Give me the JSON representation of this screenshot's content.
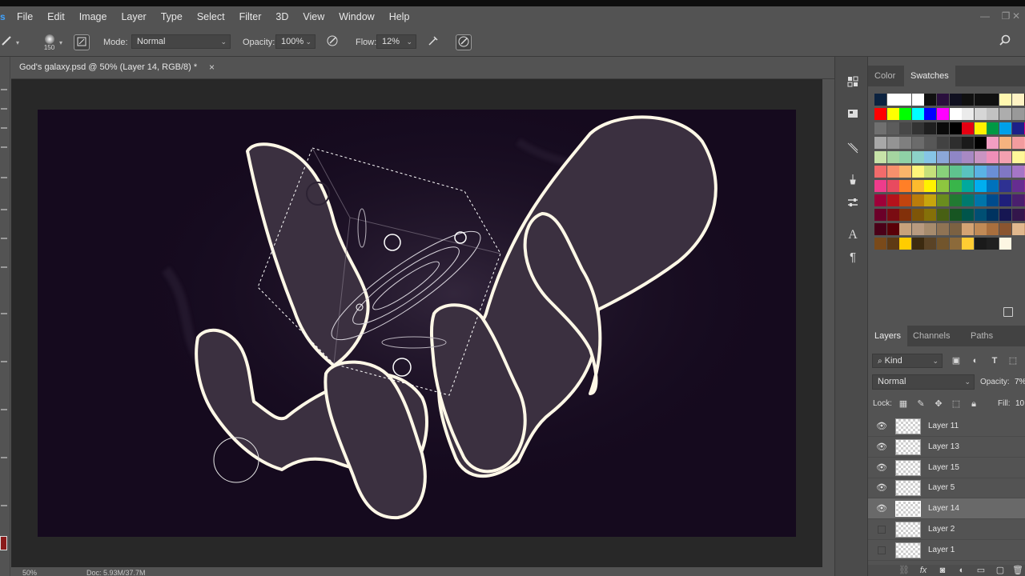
{
  "app": {
    "logo": "Ps"
  },
  "menu": [
    "File",
    "Edit",
    "Image",
    "Layer",
    "Type",
    "Select",
    "Filter",
    "3D",
    "View",
    "Window",
    "Help"
  ],
  "window_controls": {
    "minimize": "—",
    "restore": "❐",
    "close": "✕"
  },
  "options": {
    "brush_size": "150",
    "mode_label": "Mode:",
    "mode_value": "Normal",
    "opacity_label": "Opacity:",
    "opacity_value": "100%",
    "flow_label": "Flow:",
    "flow_value": "12%"
  },
  "document": {
    "tab_title": "God's galaxy.psd @ 50% (Layer 14, RGB/8) *",
    "close_glyph": "×"
  },
  "status": {
    "zoom": "50%",
    "doc_info": "Doc: 5.93M/37.7M"
  },
  "swatches_panel": {
    "tabs": [
      "Color",
      "Swatches"
    ],
    "active_tab": "Swatches",
    "rows": [
      [
        "#0c2340",
        "#ffffff",
        "#ffffff",
        "#ffffff",
        "#101010",
        "#2a0f3d",
        "#101020",
        "#101010",
        "#101010",
        "#101010",
        "#fff7b0",
        "#fff3c4",
        "#2a1a10"
      ],
      [
        "#ff0000",
        "#ffff00",
        "#00ff00",
        "#00ffff",
        "#0000ff",
        "#ff00ff",
        "#ffffff",
        "#ebebeb",
        "#d6d6d6",
        "#c2c2c2",
        "#adadad",
        "#999999",
        "#858585"
      ],
      [
        "#707070",
        "#5c5c5c",
        "#474747",
        "#333333",
        "#1f1f1f",
        "#0a0a0a",
        "#000000",
        "#e60012",
        "#fff100",
        "#009944",
        "#00a0e9",
        "#1d2088",
        "#e4007f"
      ],
      [
        "#a8a8a8",
        "#949494",
        "#7f7f7f",
        "#6b6b6b",
        "#575757",
        "#424242",
        "#2e2e2e",
        "#1a1a1a",
        "#000000",
        "#f19ec2",
        "#f6b37f",
        "#f29c9f",
        "#ffaaaa"
      ],
      [
        "#c7e3a8",
        "#a5d5a0",
        "#8fd1a6",
        "#8cd2c8",
        "#86c5e6",
        "#8ba7d8",
        "#8f86c6",
        "#a889c4",
        "#c994c2",
        "#ee8fb8",
        "#f3a0b0",
        "#fff799",
        "#ffe58f"
      ],
      [
        "#f26b6b",
        "#f7906c",
        "#f9b46a",
        "#fff57a",
        "#c6e07a",
        "#88d17a",
        "#5fc38e",
        "#5ac3c0",
        "#5ab2e4",
        "#6a8fd6",
        "#8077c4",
        "#a576c6",
        "#cf78c0"
      ],
      [
        "#ee3c8c",
        "#e84a5f",
        "#ff7f27",
        "#fdbb2d",
        "#fff200",
        "#8dc63f",
        "#39b54a",
        "#00a99d",
        "#00aeef",
        "#0072bc",
        "#2e3192",
        "#662d91",
        "#92278f"
      ],
      [
        "#9e0039",
        "#b5121b",
        "#c1440e",
        "#ba7c0b",
        "#c7a50d",
        "#6a8c1e",
        "#227a32",
        "#007a6e",
        "#0075a9",
        "#004b8d",
        "#1f1f7a",
        "#4a1f6e",
        "#6e1a6b"
      ],
      [
        "#6b0029",
        "#7a0c12",
        "#82300a",
        "#7e5508",
        "#857009",
        "#486014",
        "#175522",
        "#00554b",
        "#004f73",
        "#003360",
        "#161652",
        "#33164b",
        "#4b1249"
      ],
      [
        "#4a0018",
        "#5a0008",
        "#c8a27c",
        "#b89a80",
        "#a68b6d",
        "#8f7354",
        "#7b6142",
        "#d4a373",
        "#c08a56",
        "#a86f3e",
        "#8a5530",
        "#e1b88e",
        "#c99a6e"
      ],
      [
        "#7a4a1a",
        "#5e3a14",
        "#ffcc00",
        "#3c2a10",
        "#5a4326",
        "#72552c",
        "#8c6a3a",
        "#ffcc33",
        "#1a1a1a",
        "#202020",
        "#fdf6e3"
      ]
    ]
  },
  "layers_panel": {
    "tabs": [
      "Layers",
      "Channels",
      "Paths"
    ],
    "active_tab": "Layers",
    "filter_label": "Kind",
    "blend_mode": "Normal",
    "opacity_label": "Opacity:",
    "opacity_value": "7%",
    "lock_label": "Lock:",
    "fill_label": "Fill:",
    "fill_value": "10",
    "layers": [
      {
        "name": "Layer 11",
        "visible": true,
        "selected": false
      },
      {
        "name": "Layer 13",
        "visible": true,
        "selected": false
      },
      {
        "name": "Layer 15",
        "visible": true,
        "selected": false
      },
      {
        "name": "Layer 5",
        "visible": true,
        "selected": false
      },
      {
        "name": "Layer 14",
        "visible": true,
        "selected": true
      },
      {
        "name": "Layer 2",
        "visible": false,
        "selected": false
      },
      {
        "name": "Layer 1",
        "visible": false,
        "selected": false
      }
    ]
  },
  "colors": {
    "canvas_bg": "#150a1e",
    "hand_fill": "#3b3040",
    "outline": "#fff8e7",
    "ps_blue": "#3fa2ff",
    "foreground_color": "#8a1b1b"
  }
}
